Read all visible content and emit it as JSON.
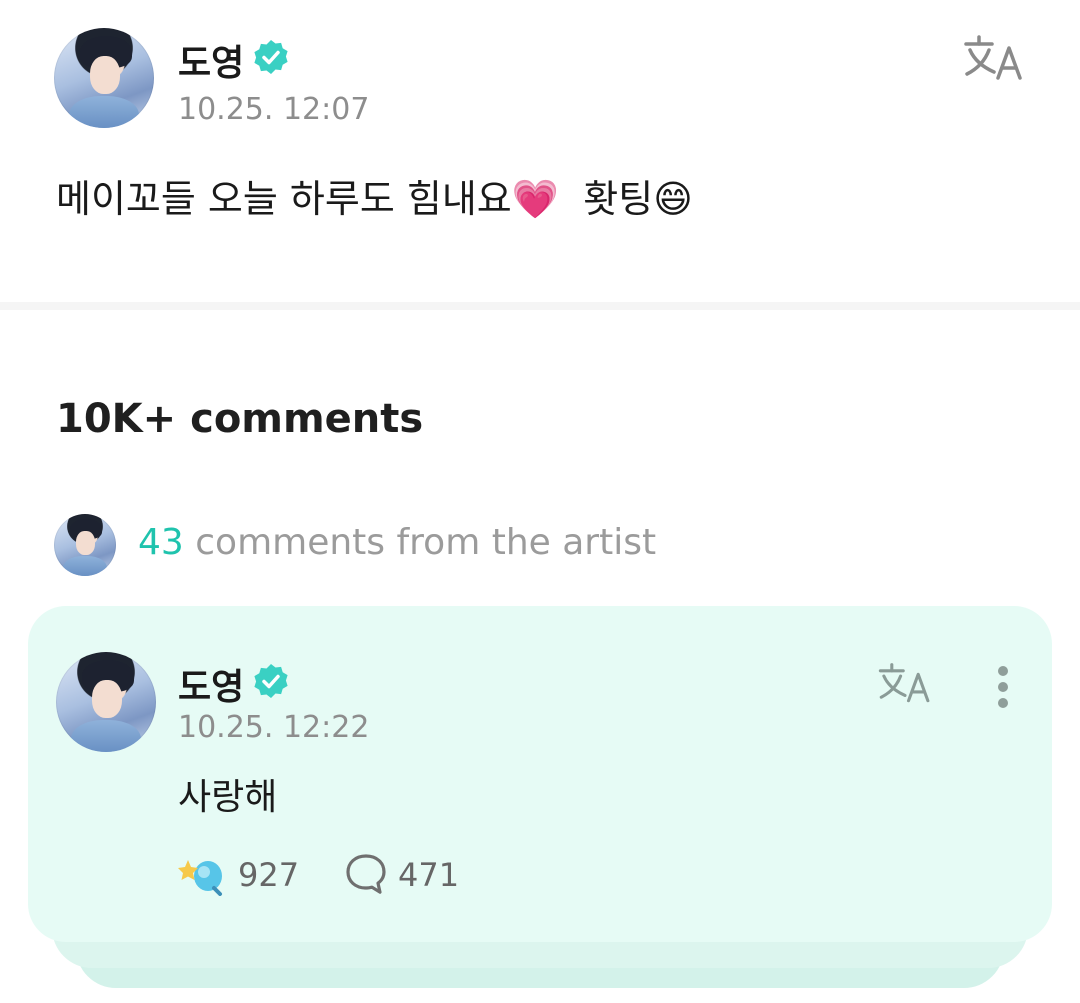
{
  "post": {
    "author": "도영",
    "timestamp": "10.25. 12:07",
    "text_main": "메이꼬들 오늘 하루도 힘내요",
    "emoji_heart": "💗",
    "text_after": "홧팅",
    "emoji_smile": "😄"
  },
  "comments_header": {
    "count_label": "10K+ comments"
  },
  "artist_comments": {
    "count": "43",
    "label": " comments from the artist"
  },
  "comment": {
    "author": "도영",
    "timestamp": "10.25. 12:22",
    "text": "사랑해",
    "likes": "927",
    "replies": "471"
  },
  "colors": {
    "accent": "#1fc3ad",
    "card_bg": "#e6fbf5",
    "verified": "#3ad0c3"
  },
  "icons": [
    "verified-badge-icon",
    "translate-icon",
    "more-options-icon",
    "reaction-icon",
    "reply-bubble-icon"
  ]
}
